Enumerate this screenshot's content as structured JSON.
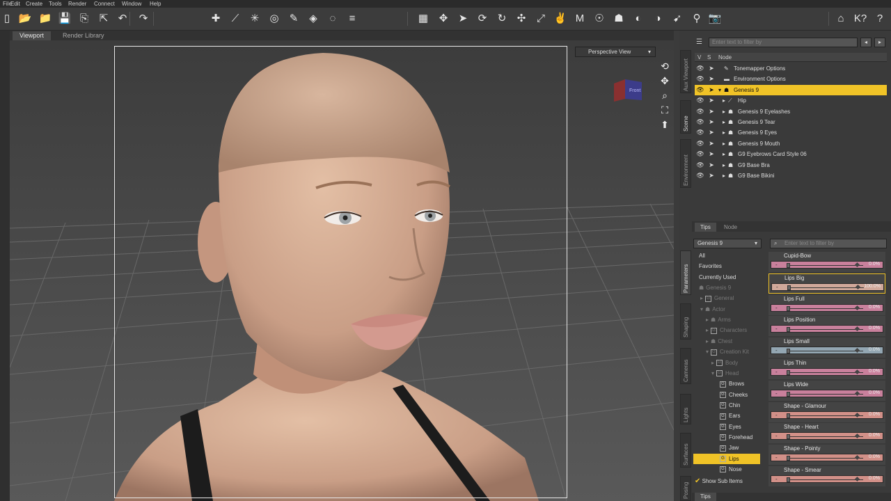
{
  "menu": [
    "File",
    "Edit",
    "Create",
    "Tools",
    "Render",
    "Connect",
    "Window",
    "Help"
  ],
  "toolbar": {
    "icons": [
      "new-icon",
      "open-icon",
      "open-folder-icon",
      "save-icon",
      "merge-icon",
      "export-icon",
      "undo-icon",
      "redo-icon",
      "add-figure-icon",
      "joint-editor-icon",
      "spot-render-icon",
      "geometry-editor-icon",
      "node-weight-icon",
      "surface-selection-icon",
      "region-navigator-icon",
      "align-icon",
      "grid-icon",
      "universal-tool-icon",
      "node-selection-icon",
      "rotate-camera-icon",
      "orbit-icon",
      "translate-icon",
      "scale-icon",
      "active-pose-icon",
      "morph-icon",
      "pose-icon",
      "figure-setup-icon",
      "surface-editor-icon",
      "shading-icon",
      "node-weight-map-icon",
      "spot-light-icon",
      "render-icon",
      "home-icon",
      "help-icon",
      "whats-this-icon"
    ],
    "accent": "#e8c232"
  },
  "viewport": {
    "tabs": [
      "Viewport",
      "Render Library"
    ],
    "active_tab": "Viewport",
    "view_label": "Perspective View",
    "cube_label": "Front"
  },
  "side_tabs_top": [
    "Aux Viewport",
    "Scene",
    "Environment"
  ],
  "side_tabs_bottom": [
    "Parameters",
    "Shaping",
    "Cameras",
    "Lights",
    "Surfaces",
    "Posing"
  ],
  "scene": {
    "filter_placeholder": "Enter text to filter by",
    "columns": {
      "v": "V",
      "s": "S",
      "node": "Node"
    },
    "rows": [
      {
        "label": "Tonemapper Options",
        "indent": 0,
        "icon": "tonemapper-icon",
        "selected": false
      },
      {
        "label": "Environment Options",
        "indent": 0,
        "icon": "environment-icon",
        "selected": false
      },
      {
        "label": "Genesis 9",
        "indent": 0,
        "icon": "figure-icon",
        "selected": true
      },
      {
        "label": "Hip",
        "indent": 1,
        "icon": "bone-icon",
        "selected": false
      },
      {
        "label": "Genesis 9 Eyelashes",
        "indent": 1,
        "icon": "figure-icon",
        "selected": false
      },
      {
        "label": "Genesis 9 Tear",
        "indent": 1,
        "icon": "figure-icon",
        "selected": false
      },
      {
        "label": "Genesis 9 Eyes",
        "indent": 1,
        "icon": "figure-icon",
        "selected": false
      },
      {
        "label": "Genesis 9 Mouth",
        "indent": 1,
        "icon": "figure-icon",
        "selected": false
      },
      {
        "label": "G9 Eyebrows Card Style 06",
        "indent": 1,
        "icon": "figure-icon",
        "selected": false
      },
      {
        "label": "G9 Base Bra",
        "indent": 1,
        "icon": "figure-icon",
        "selected": false
      },
      {
        "label": "G9 Base Bikini",
        "indent": 1,
        "icon": "figure-icon",
        "selected": false
      }
    ],
    "bottom_tabs": [
      "Tips",
      "Node"
    ],
    "selected_color": "#f0c327"
  },
  "parameters": {
    "target": "Genesis 9",
    "filter_placeholder": "Enter text to filter by",
    "tree": [
      {
        "label": "All",
        "level": 0,
        "dim": false,
        "selected": false,
        "box": false
      },
      {
        "label": "Favorites",
        "level": 0,
        "dim": false,
        "selected": false,
        "box": false
      },
      {
        "label": "Currently Used",
        "level": 0,
        "dim": false,
        "selected": false,
        "box": false
      },
      {
        "label": "Genesis 9",
        "level": 0,
        "dim": true,
        "selected": false,
        "box": false
      },
      {
        "label": "General",
        "level": 1,
        "dim": true,
        "selected": false,
        "box": true
      },
      {
        "label": "Actor",
        "level": 1,
        "dim": true,
        "selected": false,
        "box": false
      },
      {
        "label": "Arms",
        "level": 2,
        "dim": true,
        "selected": false,
        "box": false
      },
      {
        "label": "Characters",
        "level": 2,
        "dim": true,
        "selected": false,
        "box": true
      },
      {
        "label": "Chest",
        "level": 2,
        "dim": true,
        "selected": false,
        "box": false
      },
      {
        "label": "Creation Kit",
        "level": 2,
        "dim": true,
        "selected": false,
        "box": true
      },
      {
        "label": "Body",
        "level": 3,
        "dim": true,
        "selected": false,
        "box": true
      },
      {
        "label": "Head",
        "level": 3,
        "dim": true,
        "selected": false,
        "box": true
      },
      {
        "label": "Brows",
        "level": 4,
        "dim": false,
        "selected": false,
        "box": true
      },
      {
        "label": "Cheeks",
        "level": 4,
        "dim": false,
        "selected": false,
        "box": true
      },
      {
        "label": "Chin",
        "level": 4,
        "dim": false,
        "selected": false,
        "box": true
      },
      {
        "label": "Ears",
        "level": 4,
        "dim": false,
        "selected": false,
        "box": true
      },
      {
        "label": "Eyes",
        "level": 4,
        "dim": false,
        "selected": false,
        "box": true
      },
      {
        "label": "Forehead",
        "level": 4,
        "dim": false,
        "selected": false,
        "box": true
      },
      {
        "label": "Jaw",
        "level": 4,
        "dim": false,
        "selected": false,
        "box": true
      },
      {
        "label": "Lips",
        "level": 4,
        "dim": false,
        "selected": true,
        "box": true
      },
      {
        "label": "Nose",
        "level": 4,
        "dim": false,
        "selected": false,
        "box": true
      }
    ],
    "show_sub_items": "Show Sub Items",
    "sliders": [
      {
        "name": "Cupid-Bow",
        "value": "0.0%",
        "fraction": 0.0,
        "color": "#c9809c"
      },
      {
        "name": "Lips Big",
        "value": "100.0%",
        "fraction": 0.0,
        "color": "#d0a89a"
      },
      {
        "name": "Lips Full",
        "value": "0.0%",
        "fraction": 0.0,
        "color": "#c9809c"
      },
      {
        "name": "Lips Position",
        "value": "0.0%",
        "fraction": 0.0,
        "color": "#c9809c"
      },
      {
        "name": "Lips Small",
        "value": "0.0%",
        "fraction": 0.0,
        "color": "#93a6b2"
      },
      {
        "name": "Lips Thin",
        "value": "0.0%",
        "fraction": 0.0,
        "color": "#c9809c"
      },
      {
        "name": "Lips Wide",
        "value": "0.0%",
        "fraction": 0.0,
        "color": "#c9809c"
      },
      {
        "name": "Shape - Glamour",
        "value": "0.0%",
        "fraction": 0.0,
        "color": "#d29088"
      },
      {
        "name": "Shape - Heart",
        "value": "0.0%",
        "fraction": 0.0,
        "color": "#d29088"
      },
      {
        "name": "Shape - Pointy",
        "value": "0.0%",
        "fraction": 0.0,
        "color": "#d29088"
      },
      {
        "name": "Shape - Smear",
        "value": "0.0%",
        "fraction": 0.0,
        "color": "#d29088"
      }
    ],
    "bottom_tab": "Tips"
  }
}
